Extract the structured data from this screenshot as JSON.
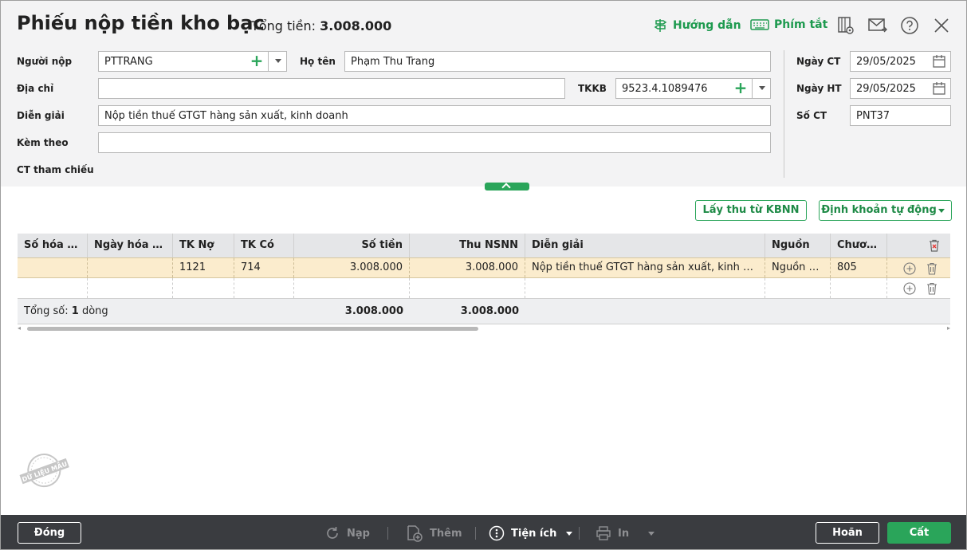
{
  "header": {
    "title": "Phiếu nộp tiền kho bạc",
    "total_label": "Tổng tiền:",
    "total_value": "3.008.000",
    "guide_label": "Hướng dẫn",
    "shortcut_label": "Phím tắt"
  },
  "form": {
    "payer_label": "Người nộp",
    "payer_value": "PTTRANG",
    "fullname_label": "Họ tên",
    "fullname_value": "Phạm Thu Trang",
    "address_label": "Địa chỉ",
    "address_value": "",
    "tkkb_label": "TKKB",
    "tkkb_value": "9523.4.1089476",
    "desc_label": "Diễn giải",
    "desc_value": "Nộp tiền thuế GTGT hàng sản xuất, kinh doanh",
    "attach_label": "Kèm theo",
    "attach_value": "",
    "ref_label": "CT tham chiếu",
    "date_ct_label": "Ngày CT",
    "date_ct_value": "29/05/2025",
    "date_ht_label": "Ngày HT",
    "date_ht_value": "29/05/2025",
    "so_ct_label": "Số CT",
    "so_ct_value": "PNT37"
  },
  "actions": {
    "fetch_kbnn": "Lấy thu từ KBNN",
    "auto_account": "Định khoản tự động"
  },
  "grid": {
    "columns": [
      "Số hóa đơn",
      "Ngày hóa đơn",
      "TK Nợ",
      "TK Có",
      "Số tiền",
      "Thu NSNN",
      "Diễn giải",
      "Nguồn",
      "Chương"
    ],
    "rows": [
      [
        "",
        "",
        "1121",
        "714",
        "3.008.000",
        "3.008.000",
        "Nộp tiền thuế GTGT hàng sản xuất, kinh doanh",
        "Nguồn ngân sách",
        "805"
      ],
      [
        "",
        "",
        "",
        "",
        "",
        "",
        "",
        "",
        ""
      ]
    ],
    "footer_label": "Tổng số:",
    "footer_count": "1",
    "footer_unit": "dòng",
    "footer_amount": "3.008.000",
    "footer_nsnn": "3.008.000"
  },
  "stamp_text": "DỮ LIỆU MẪU",
  "footer": {
    "close": "Đóng",
    "reload": "Nạp",
    "add": "Thêm",
    "utility": "Tiện ích",
    "print": "In",
    "undo": "Hoãn",
    "save": "Cất"
  },
  "colors": {
    "accent": "#2aa55a",
    "selected_row": "#fbeccd",
    "footer_bg": "#3a3c40"
  }
}
